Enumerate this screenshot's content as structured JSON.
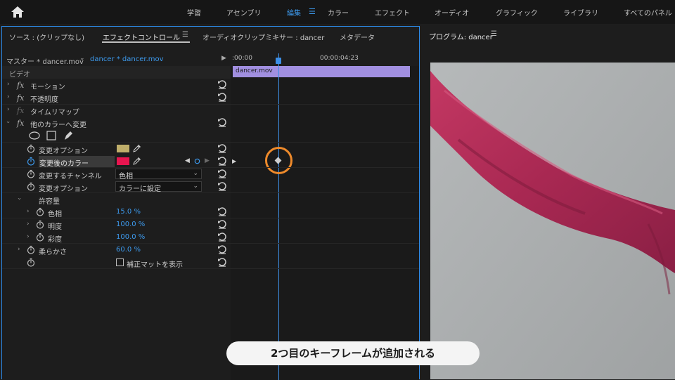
{
  "workspaces": {
    "items": [
      "学習",
      "アセンブリ",
      "編集",
      "カラー",
      "エフェクト",
      "オーディオ",
      "グラフィック",
      "ライブラリ",
      "すべてのパネル"
    ],
    "active": "編集"
  },
  "left_panel": {
    "tabs": [
      "ソース : (クリップなし)",
      "エフェクトコントロール",
      "オーディオクリップミキサー : dancer",
      "メタデータ"
    ],
    "active_tab": "エフェクトコントロール"
  },
  "clip_header": {
    "master": "マスター * dancer.mov",
    "clip": "dancer * dancer.mov",
    "timecode_start": ":00:00",
    "timecode_mid": "00:00:04:23"
  },
  "timeline": {
    "clip_label": "dancer.mov",
    "clip_color": "#a18fe0",
    "playhead_color": "#3d8fe6"
  },
  "properties": {
    "section": "ビデオ",
    "motion": "モーション",
    "opacity": "不透明度",
    "time_remap": "タイムリマップ",
    "change_to_color": "他のカラーへ変更",
    "change_option1_label": "変更オプション",
    "from_color": "#bfae6a",
    "to_color_label": "変更後のカラー",
    "to_color": "#e8154f",
    "change_channel_label": "変更するチャンネル",
    "change_channel_value": "色相",
    "change_option2_label": "変更オプション",
    "change_option2_value": "カラーに設定",
    "tolerance": "許容量",
    "hue_label": "色相",
    "hue_value": "15.0 %",
    "lightness_label": "明度",
    "lightness_value": "100.0 %",
    "saturation_label": "彩度",
    "saturation_value": "100.0 %",
    "softness_label": "柔らかさ",
    "softness_value": "60.0 %",
    "matte_label": "補正マットを表示"
  },
  "program": {
    "title": "プログラム: dancer"
  },
  "caption": "2つ目のキーフレームが追加される",
  "colors": {
    "accent": "#3d9bef",
    "highlight": "#ee8a2b",
    "panel_border": "#2d8ceb"
  }
}
